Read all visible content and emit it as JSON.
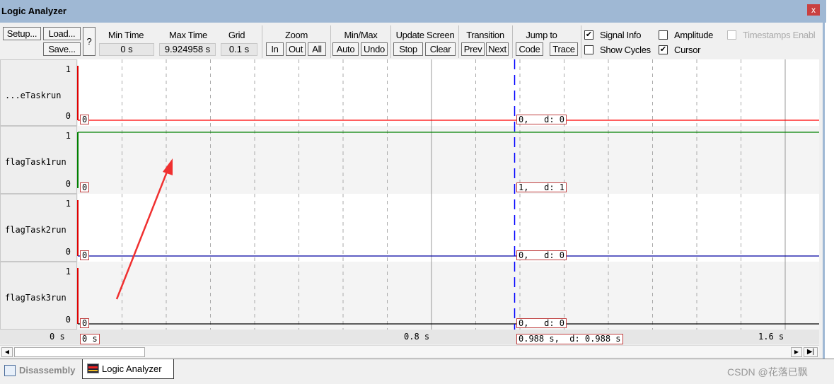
{
  "window": {
    "title": "Logic Analyzer",
    "close": "x"
  },
  "toolbar": {
    "setup": "Setup...",
    "load": "Load...",
    "save": "Save...",
    "help": "?",
    "min_time_label": "Min Time",
    "min_time": "0 s",
    "max_time_label": "Max Time",
    "max_time": "9.924958 s",
    "grid_label": "Grid",
    "grid": "0.1 s",
    "zoom_label": "Zoom",
    "zoom_in": "In",
    "zoom_out": "Out",
    "zoom_all": "All",
    "minmax_label": "Min/Max",
    "auto": "Auto",
    "undo": "Undo",
    "update_label": "Update Screen",
    "stop": "Stop",
    "clear": "Clear",
    "transition_label": "Transition",
    "prev": "Prev",
    "next": "Next",
    "jump_label": "Jump to",
    "code": "Code",
    "trace": "Trace",
    "signal_info": {
      "label": "Signal Info",
      "checked": true
    },
    "show_cycles": {
      "label": "Show Cycles",
      "checked": false
    },
    "amplitude": {
      "label": "Amplitude",
      "checked": false
    },
    "cursor": {
      "label": "Cursor",
      "checked": true
    },
    "timestamps": {
      "label": "Timestamps Enabl",
      "checked": false,
      "disabled": true
    }
  },
  "signals": [
    {
      "name": "...eTaskrun",
      "hi": "1",
      "lo": "0",
      "level": 0,
      "color": "#ff0000",
      "start_val": "0",
      "cursor_val": "0,   d: 0"
    },
    {
      "name": "flagTask1run",
      "hi": "1",
      "lo": "0",
      "level": 1,
      "color": "#008000",
      "start_val": "0",
      "cursor_val": "1,   d: 1"
    },
    {
      "name": "flagTask2run",
      "hi": "1",
      "lo": "0",
      "level": 0,
      "color": "#0000a0",
      "start_val": "0",
      "cursor_val": "0,   d: 0"
    },
    {
      "name": "flagTask3run",
      "hi": "1",
      "lo": "0",
      "level": 0,
      "color": "#000000",
      "start_val": "0",
      "cursor_val": "0,   d: 0"
    }
  ],
  "axis": {
    "left": "0 s",
    "start_box": "0 s",
    "tick_08": "0.8 s",
    "tick_16": "1.6 s",
    "cursor_box": "0.988 s,  d: 0.988 s",
    "cursor_time": 0.988,
    "grid_step": 0.1
  },
  "tabs": [
    {
      "label": "Disassembly",
      "active": false
    },
    {
      "label": "Logic Analyzer",
      "active": true
    }
  ],
  "watermark": "CSDN @花落已飘",
  "colors": {
    "cursor": "#0000ff",
    "annotation_arrow": "#f03030"
  }
}
